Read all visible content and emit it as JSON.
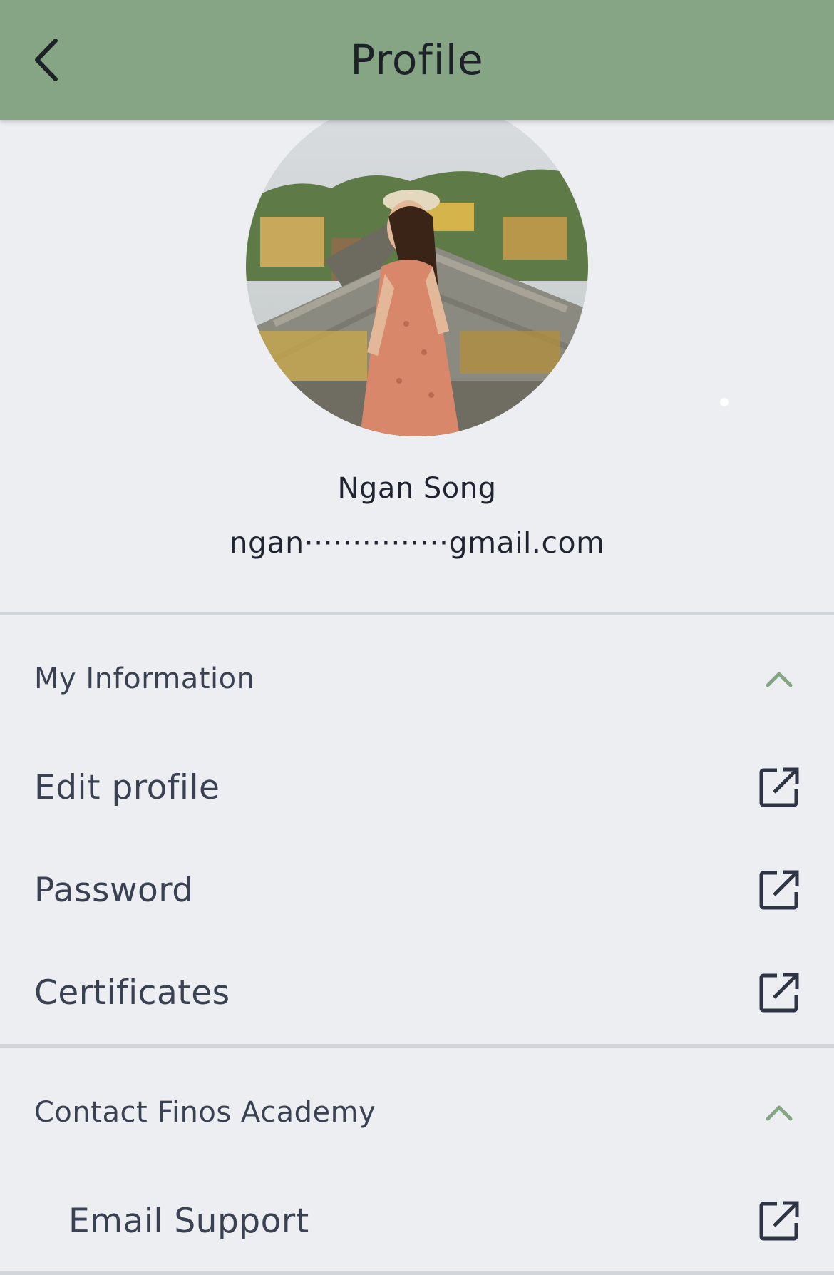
{
  "header": {
    "title": "Profile",
    "back_icon": "chevron-left-icon",
    "background": "#86a584"
  },
  "profile": {
    "name": "Ngan Song",
    "email": "ngan···············gmail.com",
    "avatar_icon": "profile-photo"
  },
  "sections": {
    "my_information": {
      "label": "My Information",
      "toggle_icon": "chevron-up-icon",
      "items": [
        {
          "label": "Edit profile",
          "icon": "external-link-icon"
        },
        {
          "label": "Password",
          "icon": "external-link-icon"
        },
        {
          "label": "Certificates",
          "icon": "external-link-icon"
        }
      ]
    },
    "contact": {
      "label": "Contact Finos Academy",
      "toggle_icon": "chevron-up-icon",
      "items": [
        {
          "label": "Email Support",
          "icon": "external-link-icon"
        }
      ]
    }
  },
  "colors": {
    "accent": "#86a584",
    "background": "#eceef1",
    "text": "#3a4152"
  }
}
